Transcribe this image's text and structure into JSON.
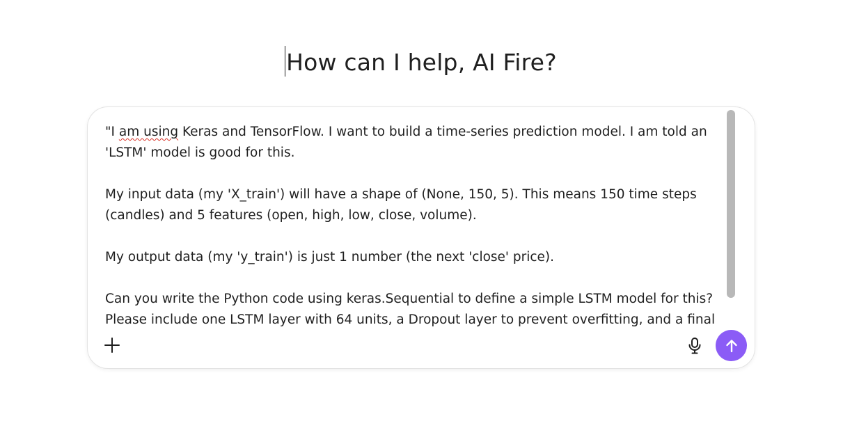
{
  "greeting": "How can I help, AI Fire?",
  "composer": {
    "prompt_lines": [
      "\"I am using Keras and TensorFlow. I want to build a time-series prediction model. I am told an 'LSTM' model is good for this.",
      "My input data (my 'X_train') will have a shape of (None, 150, 5). This means 150 time steps (candles) and 5 features (open, high, low, close, volume).",
      "My output data (my 'y_train') is just 1 number (the next 'close' price).",
      "Can you write the Python code using keras.Sequential to define a simple LSTM model for this? Please include one LSTM layer with 64 units, a Dropout layer to prevent overfitting, and a final 'Dense' layer"
    ],
    "first_line_prefix": "\"I ",
    "first_line_misspelled": "am using",
    "first_line_rest": " Keras and TensorFlow. I want to build a time-series prediction model. I am told an 'LSTM' model is good for this.",
    "icons": {
      "add": "plus-icon",
      "microphone": "microphone-icon",
      "send": "arrow-up-icon"
    },
    "colors": {
      "send_button": "#8b5cf6",
      "send_arrow": "#ffffff",
      "spellcheck_underline": "#d93025",
      "scrollbar_thumb": "#b8b8b8"
    }
  }
}
